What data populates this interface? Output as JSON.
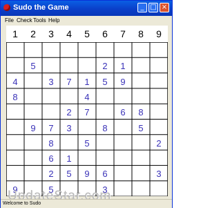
{
  "window": {
    "title": "Sudo the Game"
  },
  "title_buttons": [
    "_",
    "□",
    "×"
  ],
  "menu": [
    "File",
    "Check",
    "Tools",
    "Help"
  ],
  "number_picker": [
    "1",
    "2",
    "3",
    "4",
    "5",
    "6",
    "7",
    "8",
    "9"
  ],
  "grid": [
    [
      "",
      "",
      "",
      "",
      "",
      "",
      "",
      "",
      ""
    ],
    [
      "",
      "5",
      "",
      "",
      "",
      "2",
      "1",
      "",
      ""
    ],
    [
      "4",
      "",
      "3",
      "7",
      "1",
      "5",
      "9",
      "",
      ""
    ],
    [
      "8",
      "",
      "",
      "",
      "4",
      "",
      "",
      "",
      ""
    ],
    [
      "",
      "",
      "",
      "2",
      "7",
      "",
      "6",
      "8",
      ""
    ],
    [
      "",
      "9",
      "7",
      "3",
      "",
      "8",
      "",
      "5",
      ""
    ],
    [
      "",
      "",
      "8",
      "",
      "5",
      "",
      "",
      "",
      "2"
    ],
    [
      "",
      "",
      "6",
      "1",
      "",
      "",
      "",
      "",
      ""
    ],
    [
      "",
      "",
      "2",
      "5",
      "9",
      "6",
      "",
      "",
      "3"
    ],
    [
      "9",
      "",
      "5",
      "",
      "",
      "3",
      "",
      "",
      ""
    ]
  ],
  "watermark": "UpdateStar.com",
  "status": "Welcome to Sudo",
  "colors": {
    "given_digit": "#3a32b8",
    "titlebar": "#0a3fc9"
  }
}
